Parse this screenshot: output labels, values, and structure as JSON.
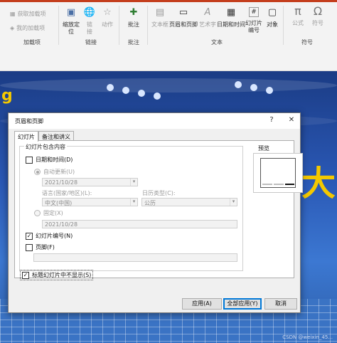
{
  "ribbon": {
    "groups": {
      "addins": "加载项",
      "links": "链接",
      "comments": "批注",
      "text": "文本",
      "symbols": "符号"
    },
    "addins": {
      "get": "获取加载项",
      "mine": "我的加载项"
    },
    "links": {
      "zoom": "缩放定",
      "zoom2": "位",
      "link": "链",
      "link2": "接",
      "action": "动作"
    },
    "comments": {
      "comment": "批注"
    },
    "text": {
      "textbox": "文本框",
      "header_footer": "页眉和页脚",
      "wordart": "艺术字",
      "datetime": "日期和时间",
      "slide_number": "幻灯片",
      "slide_number2": "编号",
      "object": "对象"
    },
    "symbols": {
      "equation": "公式",
      "symbol": "符号"
    }
  },
  "slide": {
    "gold_text": "g",
    "gold_text2": "大",
    "watermark": "CSDN @weixin_45..."
  },
  "dialog": {
    "title": "页眉和页脚",
    "help": "?",
    "close": "✕",
    "tabs": [
      "幻灯片",
      "备注和讲义"
    ],
    "fieldset_legend": "幻灯片包含内容",
    "date_time": {
      "label": "日期和时间(D)",
      "checked": false
    },
    "auto_update": {
      "label": "自动更新(U)",
      "selected": true
    },
    "auto_date_value": "2021/10/28",
    "language_label": "语言(国家/地区)(L):",
    "language_value": "中文(中国)",
    "calendar_label": "日历类型(C):",
    "calendar_value": "公历",
    "fixed": {
      "label": "固定(X)",
      "selected": false
    },
    "fixed_value": "2021/10/28",
    "slide_number": {
      "label": "幻灯片编号(N)",
      "checked": true
    },
    "footer": {
      "label": "页脚(F)",
      "checked": false
    },
    "footer_value": "",
    "hide_title": {
      "label": "标题幻灯片中不显示(S)",
      "checked": true
    },
    "preview_label": "预览",
    "buttons": {
      "apply": "应用(A)",
      "apply_all": "全部应用(Y)",
      "cancel": "取消"
    }
  },
  "colors": {
    "accent": "#c43e1c",
    "default_button": "#0078d7"
  }
}
